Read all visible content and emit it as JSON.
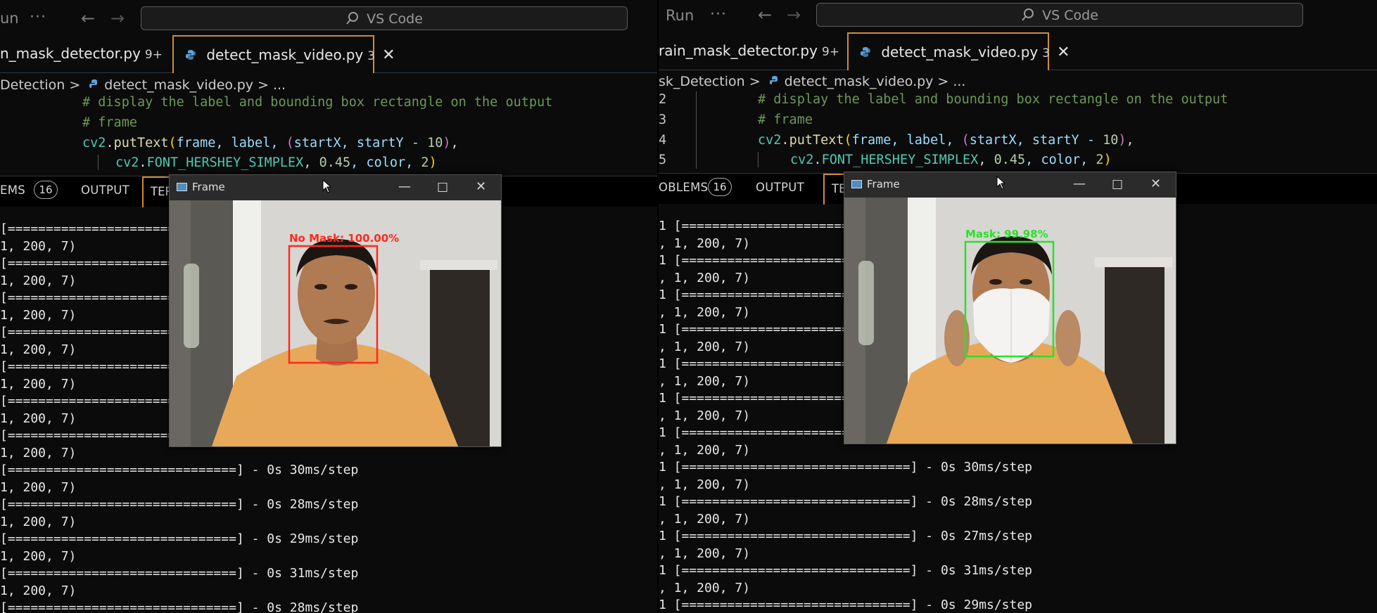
{
  "left": {
    "titlebar": {
      "run": "un",
      "dots": "···",
      "search": "VS Code"
    },
    "tabs": [
      {
        "label": "n_mask_detector.py",
        "badge": "9+"
      },
      {
        "label": "detect_mask_video.py",
        "badge": "3",
        "close": "✕"
      }
    ],
    "breadcrumb": {
      "folder": "Detection",
      "sep": ">",
      "file": "detect_mask_video.py",
      "ellipsis": "..."
    },
    "line_numbers": [
      "",
      "",
      "",
      ""
    ],
    "code": [
      {
        "comment": "# display the label and bounding box rectangle on the output"
      },
      {
        "comment": "# frame"
      },
      {
        "a": "cv2",
        "b": ".",
        "c": "putText",
        "d": "(",
        "e": "frame, label, ",
        "f": "(",
        "g": "startX, startY - ",
        "h": "10",
        "i": ")",
        "j": ","
      },
      {
        "a": "cv2",
        "b": ".",
        "c": "FONT_HERSHEY_SIMPLEX",
        "d": ", ",
        "e": "0.45",
        "f": ", color, ",
        "g": "2",
        "h": ")"
      }
    ],
    "panel": {
      "problems": "EMS",
      "problems_count": "16",
      "output": "OUTPUT",
      "terminal": "TER"
    },
    "terminal": [
      "[===========================",
      "1, 200, 7)",
      "[===========================",
      "1, 200, 7)",
      "[===========================",
      "1, 200, 7)",
      "[===========================",
      "1, 200, 7)",
      "[===========================",
      "1, 200, 7)",
      "[===========================",
      "1, 200, 7)",
      "[===========================",
      "1, 200, 7)",
      "[==============================] - 0s 30ms/step",
      "1, 200, 7)",
      "[==============================] - 0s 28ms/step",
      "1, 200, 7)",
      "[==============================] - 0s 29ms/step",
      "1, 200, 7)",
      "[==============================] - 0s 31ms/step",
      "1, 200, 7)",
      "[==============================] - 0s 28ms/step"
    ],
    "frame": {
      "title": "Frame",
      "label": "No Mask: 100.00%",
      "label_color": "#ff2a1a"
    }
  },
  "right": {
    "titlebar": {
      "run": "Run",
      "dots": "···",
      "search": "VS Code"
    },
    "tabs": [
      {
        "label": "rain_mask_detector.py",
        "badge": "9+"
      },
      {
        "label": "detect_mask_video.py",
        "badge": "3",
        "close": "✕"
      }
    ],
    "breadcrumb": {
      "folder": "sk_Detection",
      "sep": ">",
      "file": "detect_mask_video.py",
      "ellipsis": "..."
    },
    "line_numbers": [
      "2",
      "3",
      "4",
      "5"
    ],
    "code": [
      {
        "comment": "# display the label and bounding box rectangle on the output"
      },
      {
        "comment": "# frame"
      },
      {
        "a": "cv2",
        "b": ".",
        "c": "putText",
        "d": "(",
        "e": "frame, label, ",
        "f": "(",
        "g": "startX, startY - ",
        "h": "10",
        "i": ")",
        "j": ","
      },
      {
        "a": "cv2",
        "b": ".",
        "c": "FONT_HERSHEY_SIMPLEX",
        "d": ", ",
        "e": "0.45",
        "f": ", color, ",
        "g": "2",
        "h": ")"
      }
    ],
    "panel": {
      "problems": "OBLEMS",
      "problems_count": "16",
      "output": "OUTPUT",
      "terminal": "TER"
    },
    "terminal": [
      "1 [=========================",
      ", 1, 200, 7)",
      "1 [=========================",
      ", 1, 200, 7)",
      "1 [=========================",
      ", 1, 200, 7)",
      "1 [=========================",
      ", 1, 200, 7)",
      "1 [=========================",
      ", 1, 200, 7)",
      "1 [=========================",
      ", 1, 200, 7)",
      "1 [=========================",
      ", 1, 200, 7)",
      "1 [==============================] - 0s 30ms/step",
      ", 1, 200, 7)",
      "1 [==============================] - 0s 28ms/step",
      ", 1, 200, 7)",
      "1 [==============================] - 0s 27ms/step",
      ", 1, 200, 7)",
      "1 [==============================] - 0s 31ms/step",
      ", 1, 200, 7)",
      "1 [==============================] - 0s 29ms/step"
    ],
    "frame": {
      "title": "Frame",
      "label": "Mask: 99.98%",
      "label_color": "#2be02b"
    }
  }
}
